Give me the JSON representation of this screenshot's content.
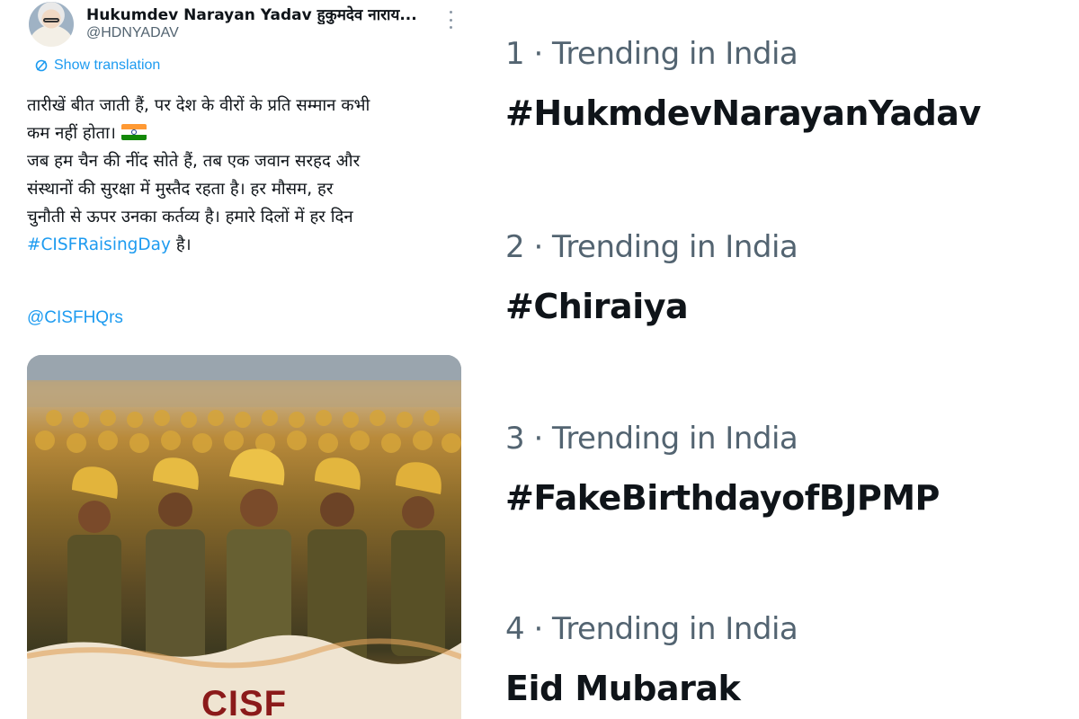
{
  "tweet": {
    "author_name": "Hukumdev Narayan Yadav हुकुमदेव नाराय...",
    "author_handle": "@HDNYADAV",
    "translate_label": "Show translation",
    "text_lines": [
      "तारीखें बीत जाती हैं, पर देश के वीरों के प्रति सम्मान कभी",
      "कम नहीं होता।",
      "जब हम चैन की नींद सोते हैं, तब एक जवान सरहद और",
      "संस्थानों की सुरक्षा में मुस्तैद रहता है। हर मौसम, हर",
      "चुनौती से ऊपर उनका कर्तव्य है। हमारे दिलों में हर दिन"
    ],
    "hashtag": "#CISFRaisingDay",
    "hashtag_suffix": " है।",
    "mention": "@CISFHQrs",
    "media_caption": "CISF",
    "flag_colors": [
      "#ff9933",
      "#ffffff",
      "#138808"
    ]
  },
  "trends": [
    {
      "meta": "1 · Trending in India",
      "name": "#HukmdevNarayanYadav"
    },
    {
      "meta": "2 · Trending in India",
      "name": "#Chiraiya"
    },
    {
      "meta": "3 · Trending in India",
      "name": "#FakeBirthdayofBJPMP"
    },
    {
      "meta": "4 · Trending in India",
      "name": "Eid Mubarak"
    }
  ],
  "colors": {
    "link": "#1d9bf0",
    "secondary_text": "#536471",
    "primary_text": "#0f1419",
    "caption_red": "#8b1a1a"
  }
}
